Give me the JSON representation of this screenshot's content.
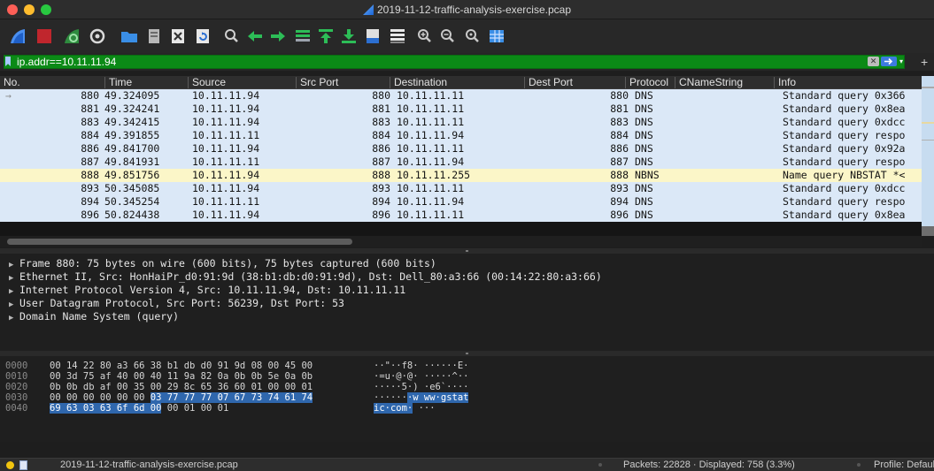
{
  "window": {
    "title": "2019-11-12-traffic-analysis-exercise.pcap"
  },
  "toolbar": {
    "icons": [
      "shark-fin-start-icon",
      "stop-capture-icon",
      "restart-capture-icon",
      "capture-options-icon",
      "open-file-icon",
      "save-file-icon",
      "close-file-icon",
      "reload-file-icon",
      "find-packet-icon",
      "go-back-icon",
      "go-forward-icon",
      "go-to-packet-icon",
      "go-first-packet-icon",
      "go-last-packet-icon",
      "auto-scroll-icon",
      "colorize-icon",
      "zoom-in-icon",
      "zoom-out-icon",
      "zoom-normal-icon",
      "resize-columns-icon"
    ]
  },
  "filter": {
    "value": "ip.addr==10.11.11.94"
  },
  "columns": [
    "No.",
    "Time",
    "Source",
    "Src Port",
    "Destination",
    "Dest Port",
    "Protocol",
    "CNameString",
    "Info"
  ],
  "packets": [
    {
      "no": "880",
      "time": "49.324095",
      "source": "10.11.11.94",
      "dst_no": "880",
      "destination": "10.11.11.11",
      "dport": "880",
      "protocol": "DNS",
      "info": "Standard query 0x366"
    },
    {
      "no": "881",
      "time": "49.324241",
      "source": "10.11.11.94",
      "dst_no": "881",
      "destination": "10.11.11.11",
      "dport": "881",
      "protocol": "DNS",
      "info": "Standard query 0x8ea"
    },
    {
      "no": "883",
      "time": "49.342415",
      "source": "10.11.11.94",
      "dst_no": "883",
      "destination": "10.11.11.11",
      "dport": "883",
      "protocol": "DNS",
      "info": "Standard query 0xdcc"
    },
    {
      "no": "884",
      "time": "49.391855",
      "source": "10.11.11.11",
      "dst_no": "884",
      "destination": "10.11.11.94",
      "dport": "884",
      "protocol": "DNS",
      "info": "Standard query respo"
    },
    {
      "no": "886",
      "time": "49.841700",
      "source": "10.11.11.94",
      "dst_no": "886",
      "destination": "10.11.11.11",
      "dport": "886",
      "protocol": "DNS",
      "info": "Standard query 0x92a"
    },
    {
      "no": "887",
      "time": "49.841931",
      "source": "10.11.11.11",
      "dst_no": "887",
      "destination": "10.11.11.94",
      "dport": "887",
      "protocol": "DNS",
      "info": "Standard query respo"
    },
    {
      "no": "888",
      "time": "49.851756",
      "source": "10.11.11.94",
      "dst_no": "888",
      "destination": "10.11.11.255",
      "dport": "888",
      "protocol": "NBNS",
      "info": "Name query NBSTAT *<"
    },
    {
      "no": "893",
      "time": "50.345085",
      "source": "10.11.11.94",
      "dst_no": "893",
      "destination": "10.11.11.11",
      "dport": "893",
      "protocol": "DNS",
      "info": "Standard query 0xdcc"
    },
    {
      "no": "894",
      "time": "50.345254",
      "source": "10.11.11.11",
      "dst_no": "894",
      "destination": "10.11.11.94",
      "dport": "894",
      "protocol": "DNS",
      "info": "Standard query respo"
    },
    {
      "no": "896",
      "time": "50.824438",
      "source": "10.11.11.94",
      "dst_no": "896",
      "destination": "10.11.11.11",
      "dport": "896",
      "protocol": "DNS",
      "info": "Standard query 0x8ea"
    }
  ],
  "details": [
    "Frame 880: 75 bytes on wire (600 bits), 75 bytes captured (600 bits)",
    "Ethernet II, Src: HonHaiPr_d0:91:9d (38:b1:db:d0:91:9d), Dst: Dell_80:a3:66 (00:14:22:80:a3:66)",
    "Internet Protocol Version 4, Src: 10.11.11.94, Dst: 10.11.11.11",
    "User Datagram Protocol, Src Port: 56239, Dst Port: 53",
    "Domain Name System (query)"
  ],
  "bytes": [
    {
      "offset": "0000",
      "hex": "00 14 22 80 a3 66 38 b1  db d0 91 9d 08 00 45 00",
      "hex_hl": "",
      "hex_tail": "",
      "ascii": "··\"··f8· ······E·",
      "ascii_hl": "",
      "ascii_tail": ""
    },
    {
      "offset": "0010",
      "hex": "00 3d 75 af 40 00 40 11  9a 82 0a 0b 0b 5e 0a 0b",
      "hex_hl": "",
      "hex_tail": "",
      "ascii": "·=u·@·@· ·····^··",
      "ascii_hl": "",
      "ascii_tail": ""
    },
    {
      "offset": "0020",
      "hex": "0b 0b db af 00 35 00 29  8c 65 36 60 01 00 00 01",
      "hex_hl": "",
      "hex_tail": "",
      "ascii": "·····5·) ·e6`····",
      "ascii_hl": "",
      "ascii_tail": ""
    },
    {
      "offset": "0030",
      "hex": "00 00 00 00 00 00 ",
      "hex_hl": "03 77  77 77 07 67 73 74 61 74",
      "hex_tail": "",
      "ascii": "······",
      "ascii_hl": "·w ww·gstat",
      "ascii_tail": ""
    },
    {
      "offset": "0040",
      "hex": "",
      "hex_hl": "69 63 03 63 6f 6d 00",
      "hex_tail": " 00  01 00 01",
      "ascii": "",
      "ascii_hl": "ic·com·",
      "ascii_tail": " ···"
    }
  ],
  "status": {
    "file": "2019-11-12-traffic-analysis-exercise.pcap",
    "packets": "Packets: 22828 · Displayed: 758 (3.3%)",
    "profile": "Profile: Default"
  }
}
